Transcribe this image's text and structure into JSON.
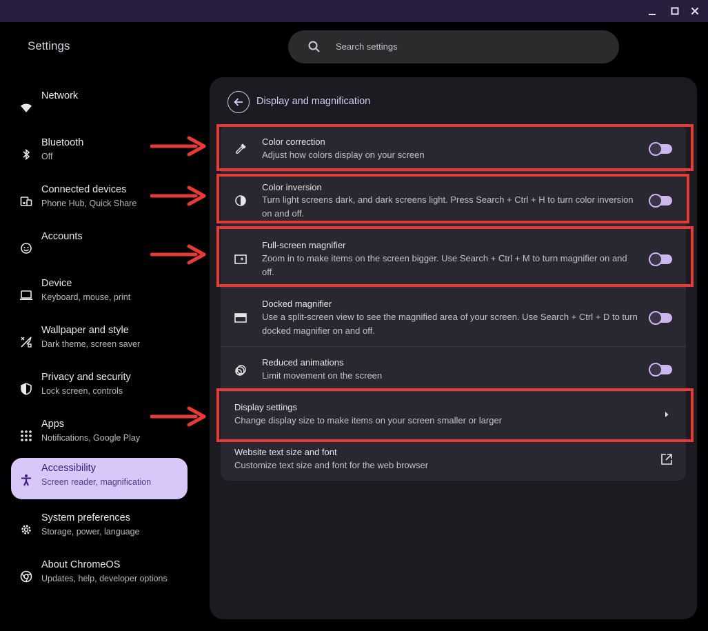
{
  "app": {
    "title": "Settings"
  },
  "window": {
    "minimize_icon": "minimize-icon",
    "maximize_icon": "maximize-icon",
    "close_icon": "close-icon"
  },
  "search": {
    "placeholder": "Search settings",
    "icon": "search-icon"
  },
  "sidebar": {
    "items": [
      {
        "label": "Network",
        "sub": "",
        "icon": "wifi-icon"
      },
      {
        "label": "Bluetooth",
        "sub": "Off",
        "icon": "bluetooth-icon"
      },
      {
        "label": "Connected devices",
        "sub": "Phone Hub, Quick Share",
        "icon": "connected-devices-icon"
      },
      {
        "label": "Accounts",
        "sub": "",
        "icon": "account-icon"
      },
      {
        "label": "Device",
        "sub": "Keyboard, mouse, print",
        "icon": "laptop-icon"
      },
      {
        "label": "Wallpaper and style",
        "sub": "Dark theme, screen saver",
        "icon": "palette-icon"
      },
      {
        "label": "Privacy and security",
        "sub": "Lock screen, controls",
        "icon": "shield-icon"
      },
      {
        "label": "Apps",
        "sub": "Notifications, Google Play",
        "icon": "apps-grid-icon"
      },
      {
        "label": "Accessibility",
        "sub": "Screen reader, magnification",
        "icon": "accessibility-icon",
        "active": true
      },
      {
        "label": "System preferences",
        "sub": "Storage, power, language",
        "icon": "gear-icon"
      },
      {
        "label": "About ChromeOS",
        "sub": "Updates, help, developer options",
        "icon": "chrome-icon"
      }
    ]
  },
  "page": {
    "title": "Display and magnification",
    "back_icon": "back-arrow-icon"
  },
  "settings": [
    {
      "title": "Color correction",
      "desc": "Adjust how colors display on your screen",
      "icon": "eyedropper-icon",
      "toggle": false
    },
    {
      "title": "Color inversion",
      "desc": "Turn light screens dark, and dark screens light. Press Search + Ctrl + H to turn color inversion on and off.",
      "icon": "contrast-icon",
      "toggle": false
    },
    {
      "title": "Full-screen magnifier",
      "desc": "Zoom in to make items on the screen bigger. Use Search + Ctrl + M to turn magnifier on and off.",
      "icon": "fullscreen-magnifier-icon",
      "toggle": false
    },
    {
      "title": "Docked magnifier",
      "desc": "Use a split-screen view to see the magnified area of your screen. Use Search + Ctrl + D to turn docked magnifier on and off.",
      "icon": "docked-magnifier-icon",
      "toggle": false
    },
    {
      "title": "Reduced animations",
      "desc": "Limit movement on the screen",
      "icon": "animation-icon",
      "toggle": false
    },
    {
      "title": "Display settings",
      "desc": "Change display size to make items on your screen smaller or larger",
      "icon": "chevron-right-icon"
    },
    {
      "title": "Website text size and font",
      "desc": "Customize text size and font for the web browser",
      "icon": "open-external-icon"
    }
  ],
  "colors": {
    "highlight": "#e53a35",
    "accent": "#d8c8fa",
    "panel": "#1d1b22",
    "card": "#29272f"
  }
}
